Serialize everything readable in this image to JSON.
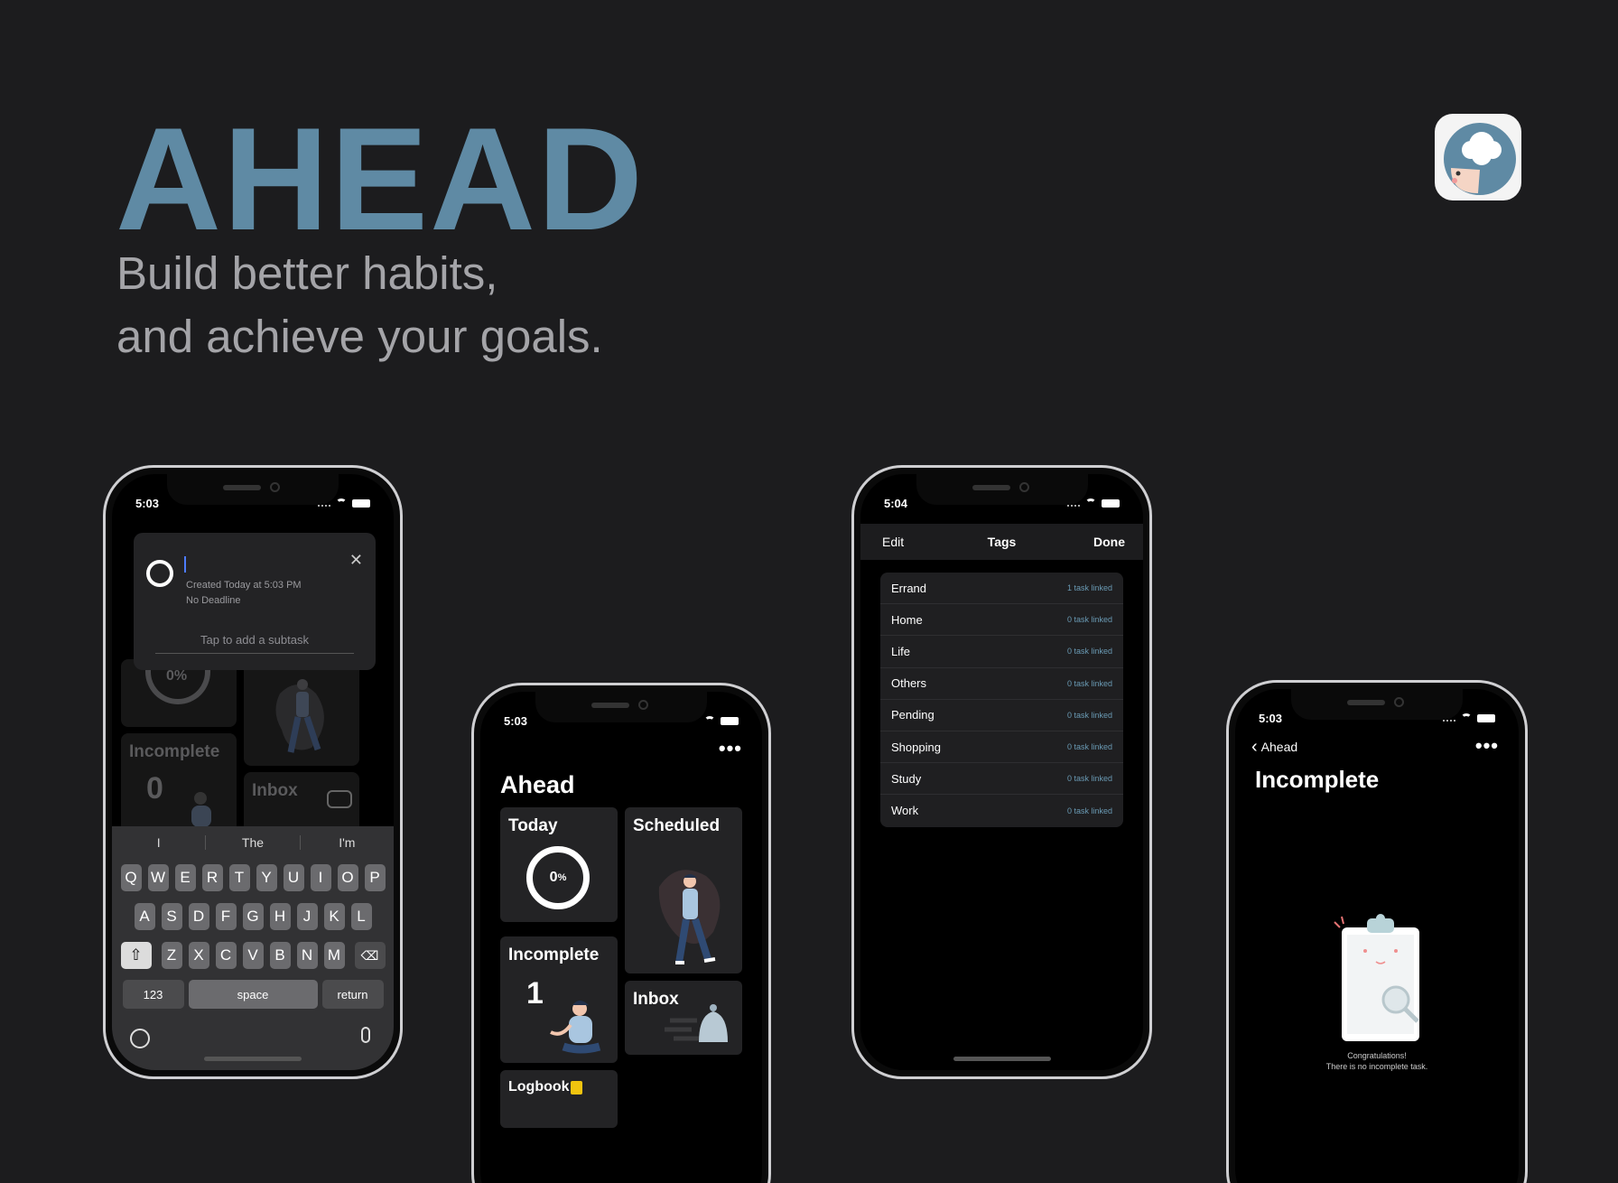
{
  "hero": {
    "brand": "AHEAD",
    "tagline_line1": "Build better habits,",
    "tagline_line2": "and achieve your goals."
  },
  "colors": {
    "brand": "#5f8aa4",
    "background": "#1c1c1e",
    "card": "#232325",
    "link": "#6a9ab4"
  },
  "phone1": {
    "time": "5:03",
    "new_task": {
      "created": "Created Today at 5:03 PM",
      "deadline": "No Deadline",
      "subtask_placeholder": "Tap to add a subtask"
    },
    "background_cards": {
      "percent": "0%",
      "incomplete_label": "Incomplete",
      "incomplete_count": "0",
      "inbox_label": "Inbox"
    },
    "keyboard": {
      "suggestions": [
        "I",
        "The",
        "I'm"
      ],
      "row1": [
        "Q",
        "W",
        "E",
        "R",
        "T",
        "Y",
        "U",
        "I",
        "O",
        "P"
      ],
      "row2": [
        "A",
        "S",
        "D",
        "F",
        "G",
        "H",
        "J",
        "K",
        "L"
      ],
      "row3": [
        "Z",
        "X",
        "C",
        "V",
        "B",
        "N",
        "M"
      ],
      "numbers_key": "123",
      "space_key": "space",
      "return_key": "return"
    }
  },
  "phone2": {
    "time": "5:03",
    "title": "Ahead",
    "today": {
      "label": "Today",
      "percent": "0",
      "percent_sign": "%"
    },
    "scheduled": {
      "label": "Scheduled"
    },
    "incomplete": {
      "label": "Incomplete",
      "count": "1"
    },
    "inbox": {
      "label": "Inbox"
    },
    "logbook": {
      "label": "Logbook"
    }
  },
  "phone3": {
    "time": "5:04",
    "nav": {
      "left": "Edit",
      "title": "Tags",
      "right": "Done"
    },
    "tags": [
      {
        "name": "Errand",
        "count": "1 task linked"
      },
      {
        "name": "Home",
        "count": "0 task linked"
      },
      {
        "name": "Life",
        "count": "0 task linked"
      },
      {
        "name": "Others",
        "count": "0 task linked"
      },
      {
        "name": "Pending",
        "count": "0 task linked"
      },
      {
        "name": "Shopping",
        "count": "0 task linked"
      },
      {
        "name": "Study",
        "count": "0 task linked"
      },
      {
        "name": "Work",
        "count": "0 task linked"
      }
    ]
  },
  "phone4": {
    "time": "5:03",
    "back": "Ahead",
    "title": "Incomplete",
    "message_line1": "Congratulations!",
    "message_line2": "There is no incomplete task."
  }
}
